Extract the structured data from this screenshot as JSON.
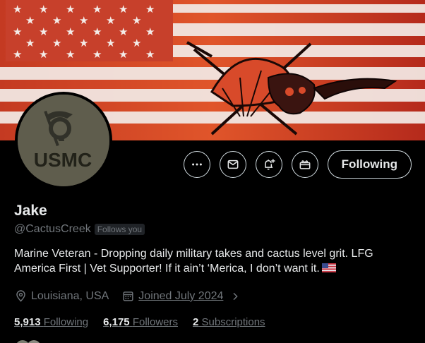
{
  "profile": {
    "name": "Jake",
    "handle": "@CactusCreek",
    "follows_you": "Follows you",
    "bio": "Marine Veteran - Dropping daily military takes and cactus level grit. LFG America First | Vet Supporter! If it ain’t ‘Merica, I don’t want it.",
    "location": "Louisiana, USA",
    "joined": "Joined July 2024",
    "avatar_text": "USMC"
  },
  "actions": {
    "follow_label": "Following",
    "buttons": [
      {
        "name": "more-icon"
      },
      {
        "name": "message-icon"
      },
      {
        "name": "notification-bell-icon"
      },
      {
        "name": "subscribe-gift-icon"
      }
    ]
  },
  "stats": {
    "following_count": "5,913",
    "following_label": "Following",
    "followers_count": "6,175",
    "followers_label": "Followers",
    "subscriptions_count": "2",
    "subscriptions_label": "Subscriptions"
  },
  "colors": {
    "background": "#000000",
    "text_primary": "#e7e9ea",
    "text_secondary": "#71767b",
    "button_border": "#cfd9de"
  }
}
